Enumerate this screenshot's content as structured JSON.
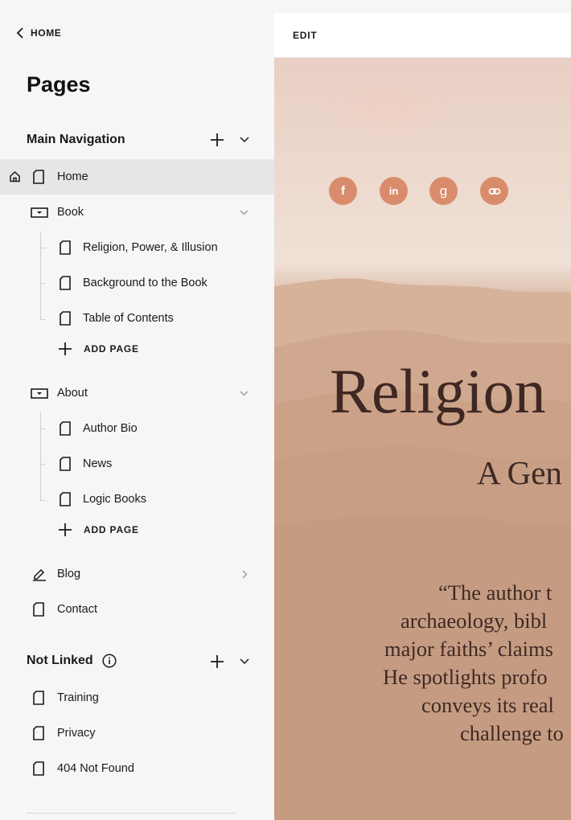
{
  "sidebar": {
    "back_label": "HOME",
    "title": "Pages",
    "main_nav": {
      "label": "Main Navigation",
      "items": [
        {
          "label": "Home"
        },
        {
          "label": "Book",
          "children": [
            "Religion, Power, & Illusion",
            "Background to the Book",
            "Table of Contents"
          ],
          "add_label": "ADD PAGE"
        },
        {
          "label": "About",
          "children": [
            "Author Bio",
            "News",
            "Logic Books"
          ],
          "add_label": "ADD PAGE"
        },
        {
          "label": "Blog"
        },
        {
          "label": "Contact"
        }
      ]
    },
    "not_linked": {
      "label": "Not Linked",
      "items": [
        "Training",
        "Privacy",
        "404 Not Found"
      ]
    }
  },
  "preview": {
    "edit_label": "EDIT",
    "social": [
      "f",
      "in",
      "g",
      "link"
    ],
    "hero_title": "Religion",
    "hero_subtitle": "A Gen",
    "quote_lines": [
      "“The author t",
      "archaeology, bibl",
      "major faiths’ claims",
      "He spotlights profo",
      "conveys its real",
      "challenge to"
    ],
    "colors": {
      "accent": "#d98c6c",
      "heading": "#3f2824",
      "active_row": "#e6e6e6"
    }
  }
}
